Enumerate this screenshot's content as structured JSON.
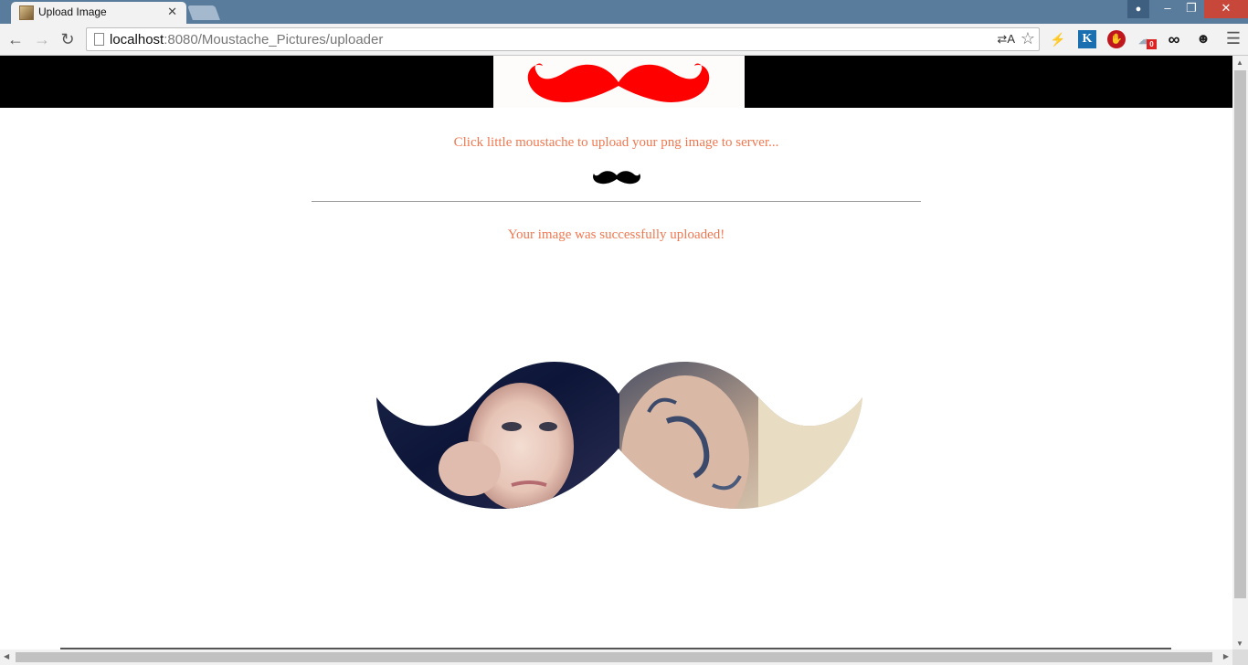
{
  "browser": {
    "tab_title": "Upload Image",
    "tab_close": "✕",
    "url_host": "localhost",
    "url_path": ":8080/Moustache_Pictures/uploader",
    "translate_icon": "translate-icon",
    "extensions": [
      "lightning-icon",
      "k-extension-icon",
      "stop-extension-icon",
      "cloud-extension-icon",
      "infinity-icon",
      "face-extension-icon"
    ],
    "cloud_badge": "0"
  },
  "colors": {
    "title_bar": "#5a7c9c",
    "page_text": "#f07850",
    "header_bar": "#000000",
    "logo_moustache": "#ff0000"
  },
  "page": {
    "instruction": "Click little moustache to upload your png image to server...",
    "success_message": "Your image was successfully uploaded!"
  }
}
